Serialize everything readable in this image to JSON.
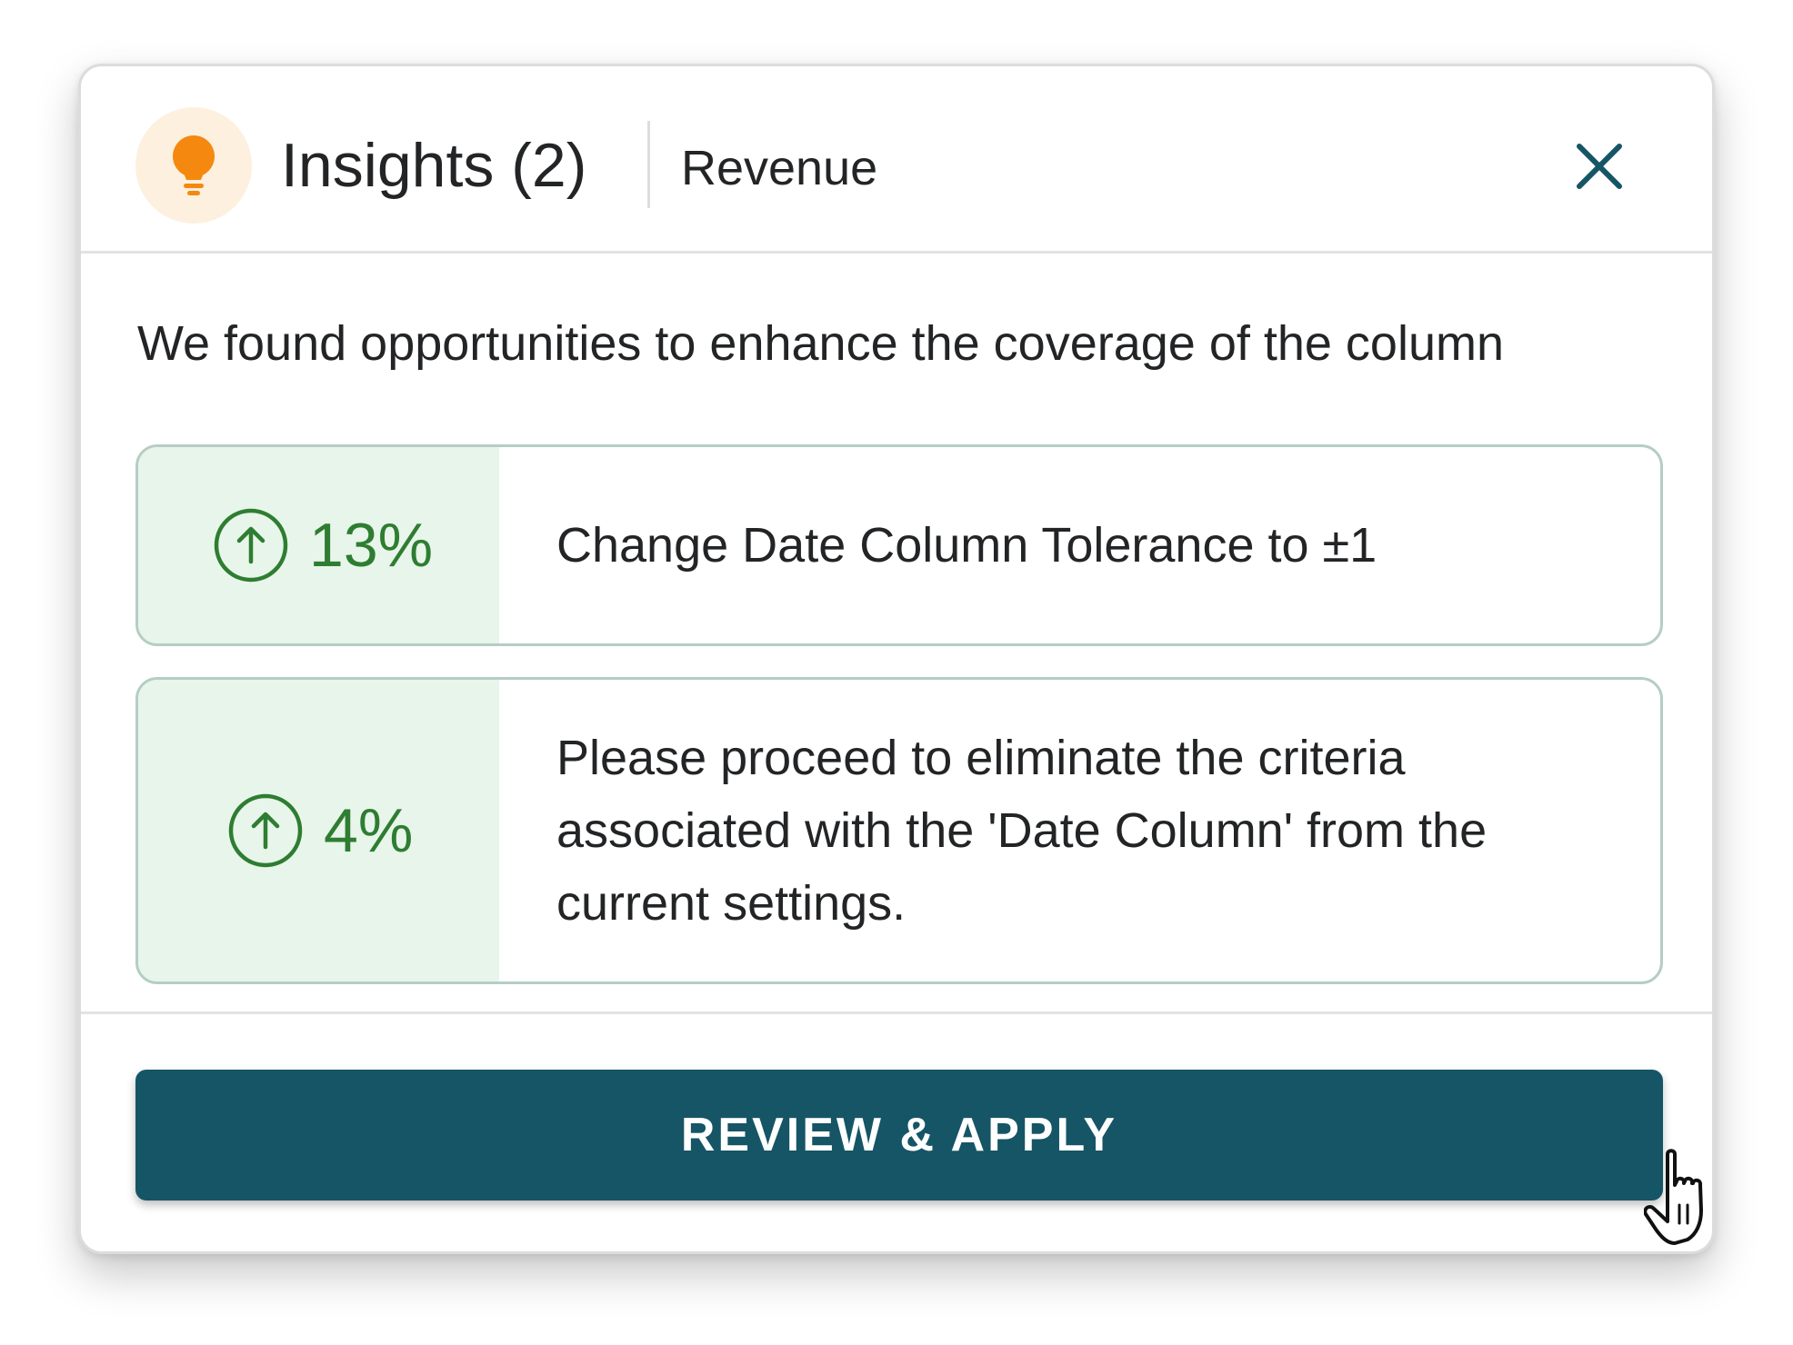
{
  "header": {
    "icon": "lightbulb-icon",
    "title": "Insights (2)",
    "subtitle": "Revenue",
    "close_icon": "close-icon"
  },
  "intro": "We found opportunities to enhance the coverage of the column",
  "insights": [
    {
      "icon": "arrow-up-circle-icon",
      "value": "13%",
      "text": "Change Date Column Tolerance to ±1"
    },
    {
      "icon": "arrow-up-circle-icon",
      "value": "4%",
      "text": "Please proceed to eliminate the criteria associated with the 'Date Column' from the current settings."
    }
  ],
  "action": {
    "label": "REVIEW & APPLY"
  },
  "colors": {
    "accent": "#155566",
    "positive": "#2e7d32",
    "positive_bg": "#e8f5ea",
    "bulb": "#f5890f",
    "bulb_bg": "#fdf0df"
  }
}
